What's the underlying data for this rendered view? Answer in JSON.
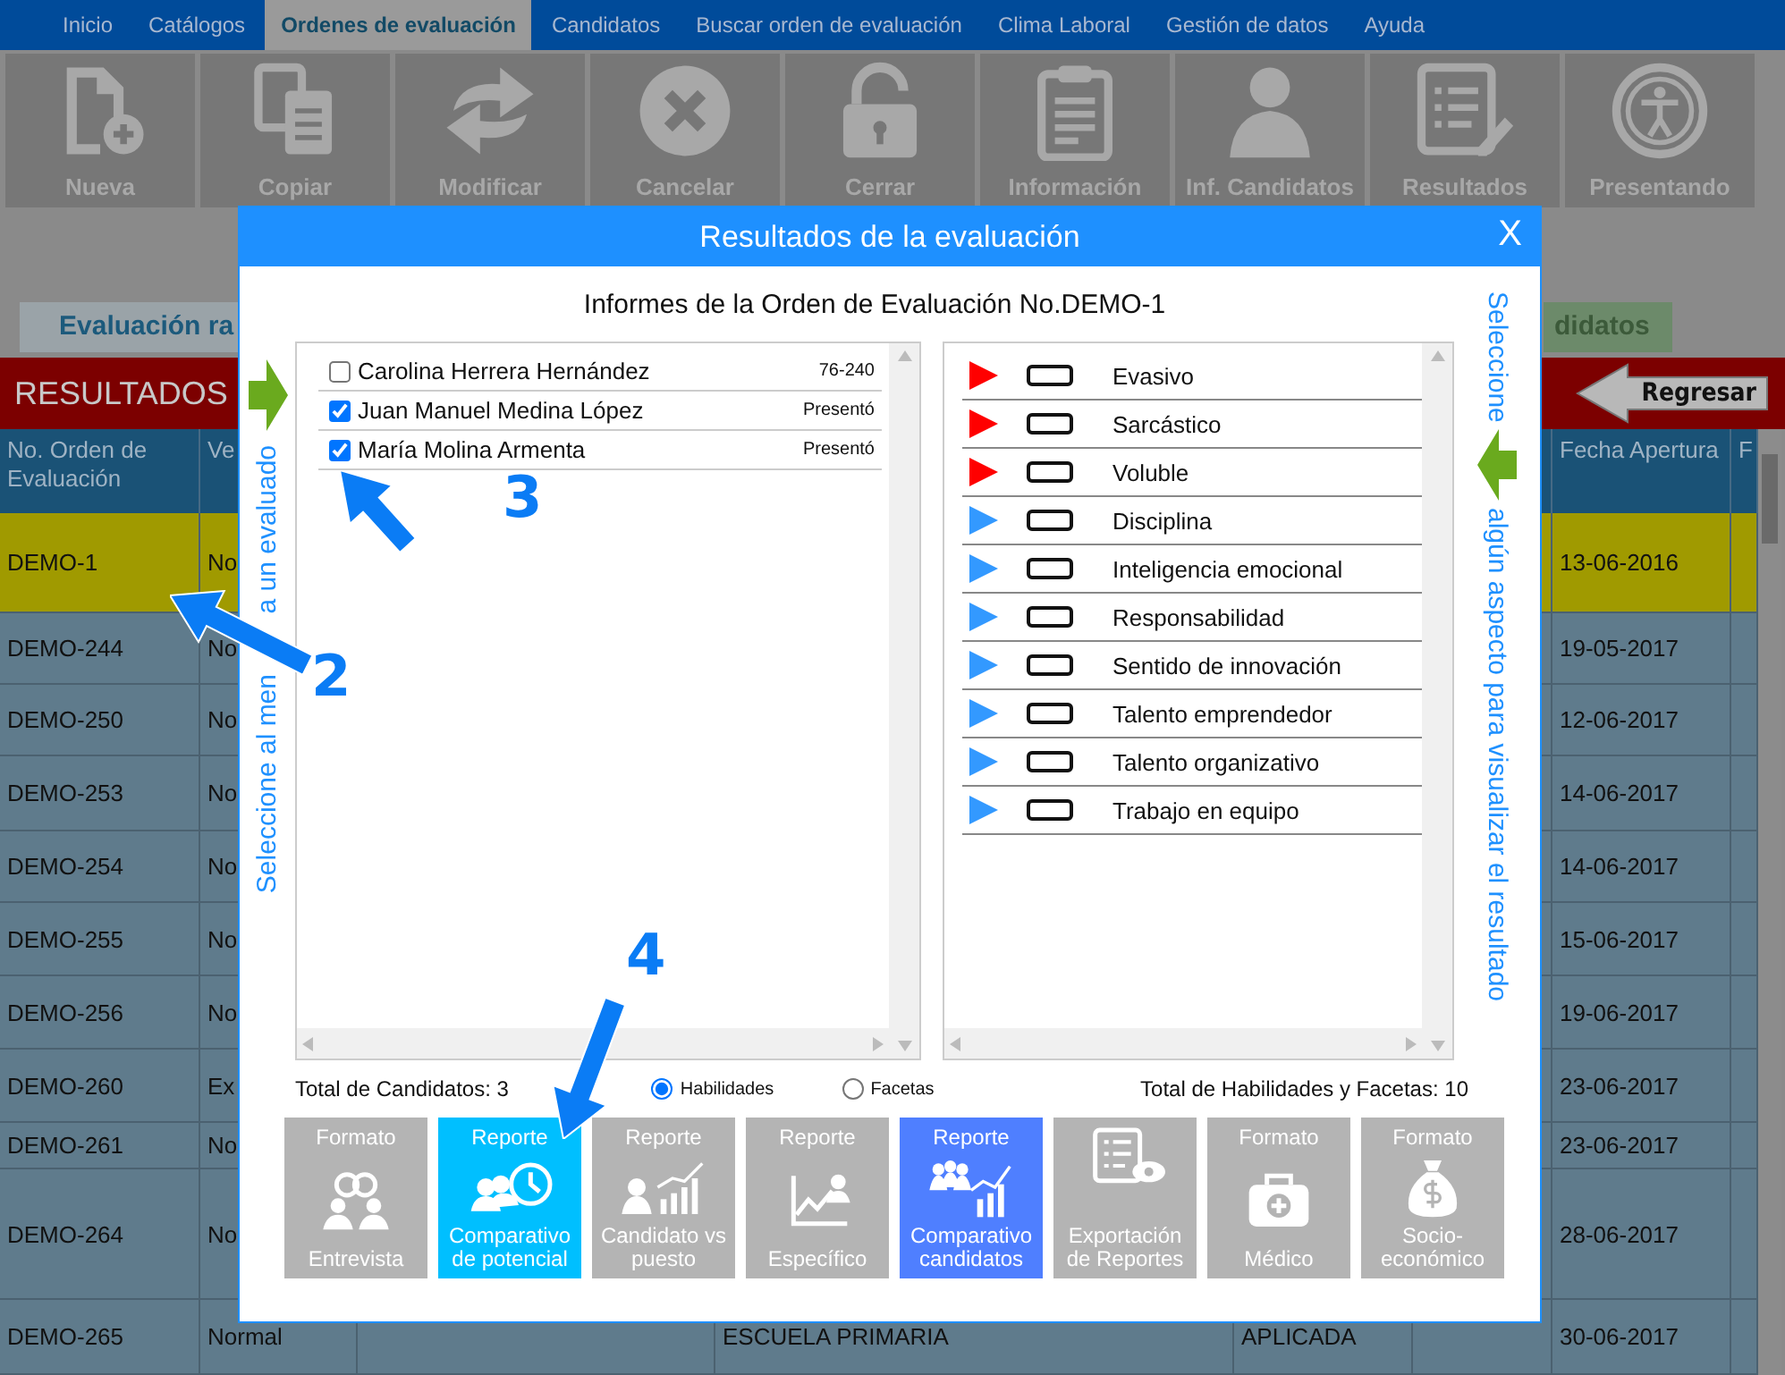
{
  "menu": [
    {
      "label": "Inicio",
      "selected": false
    },
    {
      "label": "Catálogos",
      "selected": false
    },
    {
      "label": "Ordenes de evaluación",
      "selected": true
    },
    {
      "label": "Candidatos",
      "selected": false
    },
    {
      "label": "Buscar orden de evaluación",
      "selected": false
    },
    {
      "label": "Clima Laboral",
      "selected": false
    },
    {
      "label": "Gestión de datos",
      "selected": false
    },
    {
      "label": "Ayuda",
      "selected": false
    }
  ],
  "toolbar": [
    {
      "label": "Nueva",
      "kind": "new"
    },
    {
      "label": "Copiar",
      "kind": "copy"
    },
    {
      "label": "Modificar",
      "kind": "refresh"
    },
    {
      "label": "Cancelar",
      "kind": "cancel"
    },
    {
      "label": "Cerrar",
      "kind": "lock"
    },
    {
      "label": "Información",
      "kind": "clipboard"
    },
    {
      "label": "Inf. Candidatos",
      "kind": "person"
    },
    {
      "label": "Resultados",
      "kind": "report"
    },
    {
      "label": "Presentando",
      "kind": "access"
    }
  ],
  "strip": {
    "left": "Evaluación ra",
    "right": "didatos"
  },
  "results_bar": {
    "title": "RESULTADOS",
    "back_button": "Regresar"
  },
  "table": {
    "columns": {
      "column_1": "No. Orden de Evaluación",
      "column_2": "Ve",
      "column_7": "Fecha Apertura",
      "column_8": "F"
    },
    "rows": [
      {
        "selected": true,
        "column_1": "DEMO-1",
        "column_2": "No",
        "column_7": "13-06-2016"
      },
      {
        "selected": false,
        "column_1": "DEMO-244",
        "column_2": "No",
        "column_7": "19-05-2017"
      },
      {
        "selected": false,
        "column_1": "DEMO-250",
        "column_2": "No",
        "column_7": "12-06-2017"
      },
      {
        "selected": false,
        "column_1": "DEMO-253",
        "column_2": "No",
        "column_7": "14-06-2017"
      },
      {
        "selected": false,
        "column_1": "DEMO-254",
        "column_2": "No",
        "column_7": "14-06-2017"
      },
      {
        "selected": false,
        "column_1": "DEMO-255",
        "column_2": "No",
        "column_7": "15-06-2017"
      },
      {
        "selected": false,
        "column_1": "DEMO-256",
        "column_2": "No",
        "column_7": "19-06-2017"
      },
      {
        "selected": false,
        "column_1": "DEMO-260",
        "column_2": "Ex",
        "column_7": "23-06-2017"
      },
      {
        "selected": false,
        "column_1": "DEMO-261",
        "column_2": "No",
        "column_7": "23-06-2017"
      },
      {
        "selected": false,
        "column_1": "DEMO-264",
        "column_2": "No",
        "column_7": "28-06-2017"
      },
      {
        "selected": false,
        "column_1": "DEMO-265",
        "column_2": "Normal",
        "column_4": "ESCUELA PRIMARIA",
        "column_5": "APLICADA",
        "column_7": "30-06-2017"
      }
    ]
  },
  "dialog": {
    "title": "Resultados de la evaluación",
    "close": "X",
    "subtitle": "Informes de la Orden de Evaluación No.DEMO-1",
    "left_hint": [
      "Seleccione al men",
      "a un evaluado"
    ],
    "right_hint": [
      "Seleccione",
      "algún aspecto para visualizar el resultado"
    ],
    "candidates": [
      {
        "name": "Carolina Herrera Hernández",
        "status": "76-240",
        "checked": false
      },
      {
        "name": "Juan Manuel Medina López",
        "status": "Presentó",
        "checked": true
      },
      {
        "name": "María Molina Armenta",
        "status": "Presentó",
        "checked": true
      }
    ],
    "aspects": [
      {
        "label": "Evasivo",
        "color": "#ff0000"
      },
      {
        "label": "Sarcástico",
        "color": "#ff0000"
      },
      {
        "label": "Voluble",
        "color": "#ff0000"
      },
      {
        "label": "Disciplina",
        "color": "#3399ff"
      },
      {
        "label": "Inteligencia emocional",
        "color": "#3399ff"
      },
      {
        "label": "Responsabilidad",
        "color": "#3399ff"
      },
      {
        "label": "Sentido de innovación",
        "color": "#3399ff"
      },
      {
        "label": "Talento emprendedor",
        "color": "#3399ff"
      },
      {
        "label": "Talento organizativo",
        "color": "#3399ff"
      },
      {
        "label": "Trabajo en equipo",
        "color": "#3399ff"
      }
    ],
    "total_candidates": "Total de Candidatos: 3",
    "options": [
      {
        "label": "Habilidades",
        "selected": true
      },
      {
        "label": "Facetas",
        "selected": false
      }
    ],
    "total_aspects": "Total de Habilidades y Facetas: 10",
    "reports": [
      {
        "top": "Formato",
        "label": "Entrevista",
        "kind": "people",
        "color": "#b4b4b4"
      },
      {
        "top": "Reporte",
        "label": "Comparativo de potencial",
        "kind": "potential",
        "color": "#00bfff"
      },
      {
        "top": "Reporte",
        "label": "Candidato vs puesto",
        "kind": "position",
        "color": "#b4b4b4"
      },
      {
        "top": "Reporte",
        "label": "Específico",
        "kind": "specific",
        "color": "#b4b4b4"
      },
      {
        "top": "Reporte",
        "label": "Comparativo candidatos",
        "kind": "group",
        "color": "#4f7fff"
      },
      {
        "label": "Exportación de Reportes",
        "kind": "export",
        "color": "#b4b4b4"
      },
      {
        "top": "Formato",
        "label": "Médico",
        "kind": "medical",
        "color": "#b4b4b4"
      },
      {
        "top": "Formato",
        "label": "Socio-económico",
        "kind": "money",
        "color": "#b4b4b4"
      }
    ]
  },
  "annotations": [
    {
      "number": "2"
    },
    {
      "number": "3"
    },
    {
      "number": "4"
    }
  ]
}
